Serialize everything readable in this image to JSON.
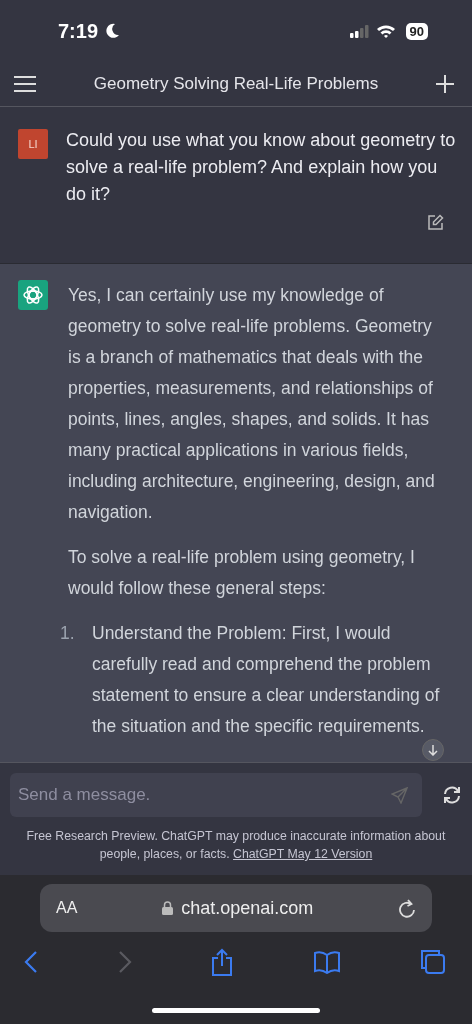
{
  "status_bar": {
    "time": "7:19",
    "battery": "90"
  },
  "header": {
    "title": "Geometry Solving Real-Life Problems"
  },
  "conversation": [
    {
      "kind": "user",
      "avatar": "LI",
      "paragraphs": [
        "Could you use what you know about geometry to solve a real-life problem? And explain how you do it?"
      ]
    },
    {
      "kind": "assistant",
      "paragraphs": [
        "Yes, I can certainly use my knowledge of geometry to solve real-life problems. Geometry is a branch of mathematics that deals with the properties, measurements, and relationships of points, lines, angles, shapes, and solids. It has many practical applications in various fields, including architecture, engineering, design, and navigation.",
        "To solve a real-life problem using geometry, I would follow these general steps:"
      ],
      "list": [
        {
          "number": "1.",
          "text": "Understand the Problem: First, I would carefully read and comprehend the problem statement to ensure a clear understanding of the situation and the specific requirements."
        }
      ]
    }
  ],
  "composer": {
    "placeholder": "Send a message."
  },
  "footer": {
    "text": "Free Research Preview. ChatGPT may produce inaccurate information about people, places, or facts.",
    "link": "ChatGPT May 12 Version"
  },
  "browser": {
    "text_size": "AA",
    "url": "chat.openai.com",
    "toolbar": [
      {
        "kind": "back",
        "disabled": false
      },
      {
        "kind": "forward",
        "disabled": true
      },
      {
        "kind": "share",
        "disabled": false
      },
      {
        "kind": "bookmarks",
        "disabled": false
      },
      {
        "kind": "tabs",
        "disabled": false
      }
    ]
  }
}
